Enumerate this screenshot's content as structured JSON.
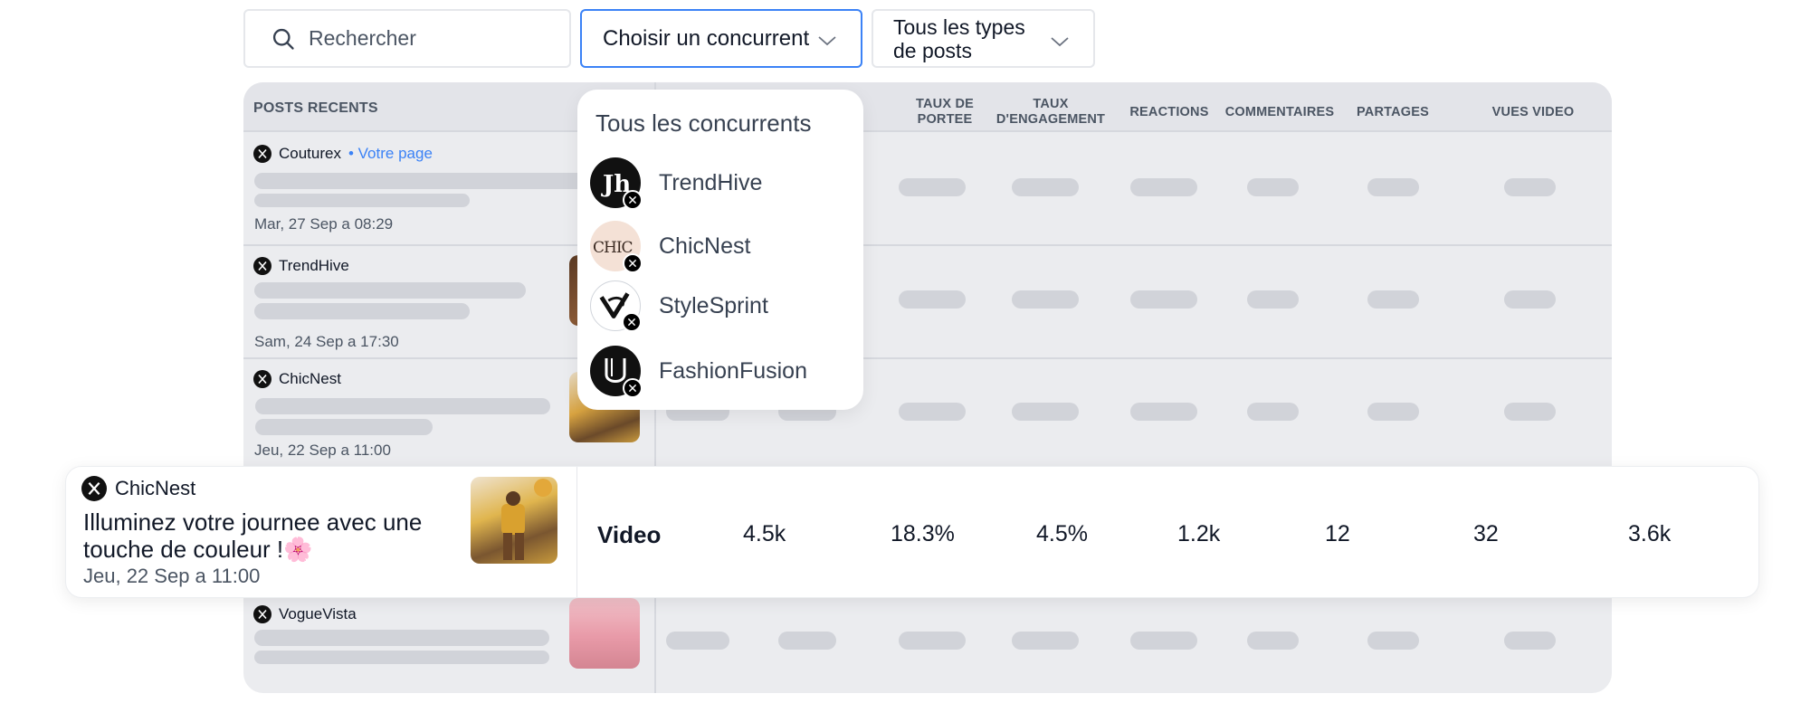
{
  "filters": {
    "search_placeholder": "Rechercher",
    "competitor_label": "Choisir un concurrent",
    "post_types_label": "Tous les types de posts"
  },
  "table": {
    "headers": {
      "posts": "POSTS RECENTS",
      "reach_rate": "TAUX DE PORTEE",
      "engagement_rate": "TAUX D'ENGAGEMENT",
      "reactions": "REACTIONS",
      "comments": "COMMENTAIRES",
      "shares": "PARTAGES",
      "video_views": "VUES VIDEO"
    },
    "rows": [
      {
        "account": "Couturex",
        "tag": "• Votre page",
        "date": "Mar, 27 Sep a 08:29"
      },
      {
        "account": "TrendHive",
        "date": "Sam, 24 Sep a 17:30"
      },
      {
        "account": "ChicNest",
        "date": "Jeu, 22 Sep a 11:00"
      },
      {
        "account": "VogueVista"
      }
    ]
  },
  "dropdown": {
    "title": "Tous les concurrents",
    "items": [
      {
        "name": "TrendHive",
        "icon": "trendhive-logo"
      },
      {
        "name": "ChicNest",
        "icon": "chicnest-logo"
      },
      {
        "name": "StyleSprint",
        "icon": "stylesprint-logo"
      },
      {
        "name": "FashionFusion",
        "icon": "fashionfusion-logo"
      }
    ]
  },
  "highlight": {
    "account": "ChicNest",
    "text": "Illuminez votre journee avec une touche de couleur !🌸",
    "date": "Jeu, 22 Sep a 11:00",
    "type": "Video",
    "reach": "4.5k",
    "reach_rate": "18.3%",
    "engagement_rate": "4.5%",
    "reactions": "1.2k",
    "comments": "12",
    "shares": "32",
    "video_views": "3.6k"
  },
  "colors": {
    "accent": "#3b82f6",
    "table_bg": "#ebecef",
    "skeleton": "#d1d3d9"
  }
}
